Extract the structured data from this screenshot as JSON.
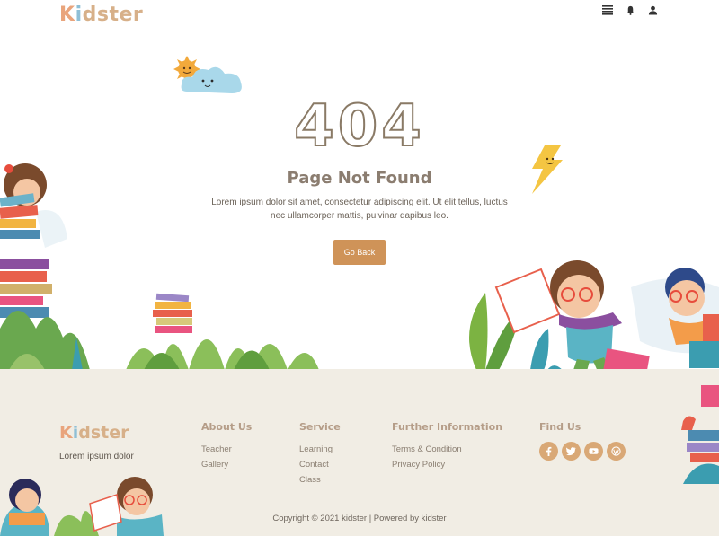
{
  "header": {
    "logo": {
      "k": "K",
      "i": "i",
      "rest": "dster"
    },
    "icons": [
      "menu-icon",
      "bell-icon",
      "user-icon"
    ]
  },
  "hero": {
    "code": "404",
    "title": "Page Not Found",
    "text": "Lorem ipsum dolor sit amet, consectetur adipiscing elit. Ut elit tellus, luctus nec ullamcorper mattis, pulvinar dapibus leo.",
    "button": "Go Back"
  },
  "footer": {
    "logo": {
      "k": "K",
      "i": "i",
      "rest": "dster"
    },
    "tagline": "Lorem ipsum dolor",
    "about": {
      "title": "About Us",
      "links": [
        "Teacher",
        "Gallery"
      ]
    },
    "service": {
      "title": "Service",
      "links": [
        "Learning",
        "Contact",
        "Class"
      ]
    },
    "further": {
      "title": "Further Information",
      "links": [
        "Terms & Condition",
        "Privacy Policy"
      ]
    },
    "find": {
      "title": "Find Us",
      "social": [
        "facebook-icon",
        "twitter-icon",
        "youtube-icon",
        "wordpress-icon"
      ]
    },
    "copyright": "Copyright © 2021 kidster | Powered by kidster"
  },
  "colors": {
    "accent": "#cf9358",
    "footer_bg": "#f1ede4",
    "heading": "#8b7d70",
    "social": "#d9a876"
  }
}
